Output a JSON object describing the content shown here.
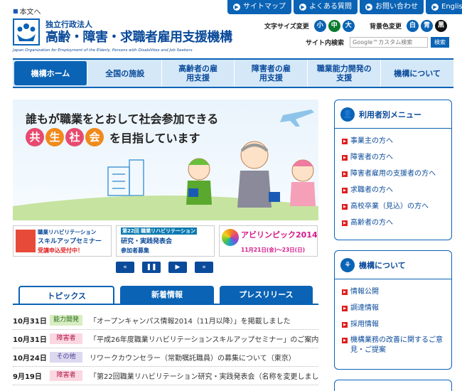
{
  "skip": {
    "label": "本文へ"
  },
  "util_nav": [
    {
      "label": "サイトマップ"
    },
    {
      "label": "よくある質問"
    },
    {
      "label": "お問い合わせ"
    },
    {
      "label": "English"
    }
  ],
  "logo": {
    "sub": "独立行政法人",
    "main": "高齢・障害・求職者雇用支援機構",
    "en": "Japan Organization for Employment of the Elderly, Persons with Disabilities and Job Seekers"
  },
  "font_size": {
    "label": "文字サイズ変更",
    "options": [
      "小",
      "中",
      "大"
    ],
    "selected": "中"
  },
  "bg_color": {
    "label": "背景色変更",
    "options": [
      "白",
      "青",
      "黒"
    ]
  },
  "search": {
    "label": "サイト内検索",
    "placeholder": "Google™カスタム検索",
    "button": "検索"
  },
  "global_nav": [
    {
      "label": "機構ホーム",
      "active": true
    },
    {
      "label": "全国の施設"
    },
    {
      "label": "高齢者の雇用支援"
    },
    {
      "label": "障害者の雇用支援"
    },
    {
      "label": "職業能力開発の支援"
    },
    {
      "label": "機構について"
    }
  ],
  "hero": {
    "line1": "誰もが職業をとおして社会参加できる",
    "kanji": [
      "共",
      "生",
      "社",
      "会"
    ],
    "tail": "を目指しています"
  },
  "banners": [
    {
      "t1": "職業リハビリテーション",
      "t2": "スキルアップセミナー",
      "t3": "受講申込受付中！"
    },
    {
      "t1": "第22回 職業リハビリテーション",
      "t2": "研究・実践発表会",
      "t3": "参加者募集"
    },
    {
      "t2": "アビリンピック2014",
      "t3": "11月21日(金)〜23日(日)"
    }
  ],
  "carousel": {
    "prev": "«",
    "pause": "❚❚",
    "play": "▶",
    "next": "»"
  },
  "tabs": [
    {
      "label": "トピックス",
      "active": true
    },
    {
      "label": "新着情報"
    },
    {
      "label": "プレスリリース"
    }
  ],
  "news": [
    {
      "date": "10月31日",
      "category": "能力開発",
      "title": "「オープンキャンパス情報2014（11月以降）」を掲載しました"
    },
    {
      "date": "10月31日",
      "category": "障害者",
      "title": "「平成26年度職業リハビリテーションスキルアップセミナー」のご案内"
    },
    {
      "date": "10月24日",
      "category": "その他",
      "title": "リワークカウンセラー（常勤嘱託職員）の募集について（東京）"
    },
    {
      "date": "9月19日",
      "category": "障害者",
      "title": "「第22回職業リハビリテーション研究・実践発表会（名称を変更しまし"
    }
  ],
  "side_user_menu": {
    "title": "利用者別メニュー",
    "items": [
      "事業主の方へ",
      "障害者の方へ",
      "障害者雇用の支援者の方へ",
      "求職者の方へ",
      "高校卒業（見込）の方へ",
      "高齢者の方へ"
    ]
  },
  "side_about": {
    "title": "機構について",
    "items": [
      "情報公開",
      "調達情報",
      "採用情報",
      "機構業務の改善に関するご意見・ご提案"
    ]
  },
  "colors": {
    "brand_blue": "#0a63b5",
    "nav_bg": "#d4e8f8",
    "accent_red": "#e01e1e"
  }
}
